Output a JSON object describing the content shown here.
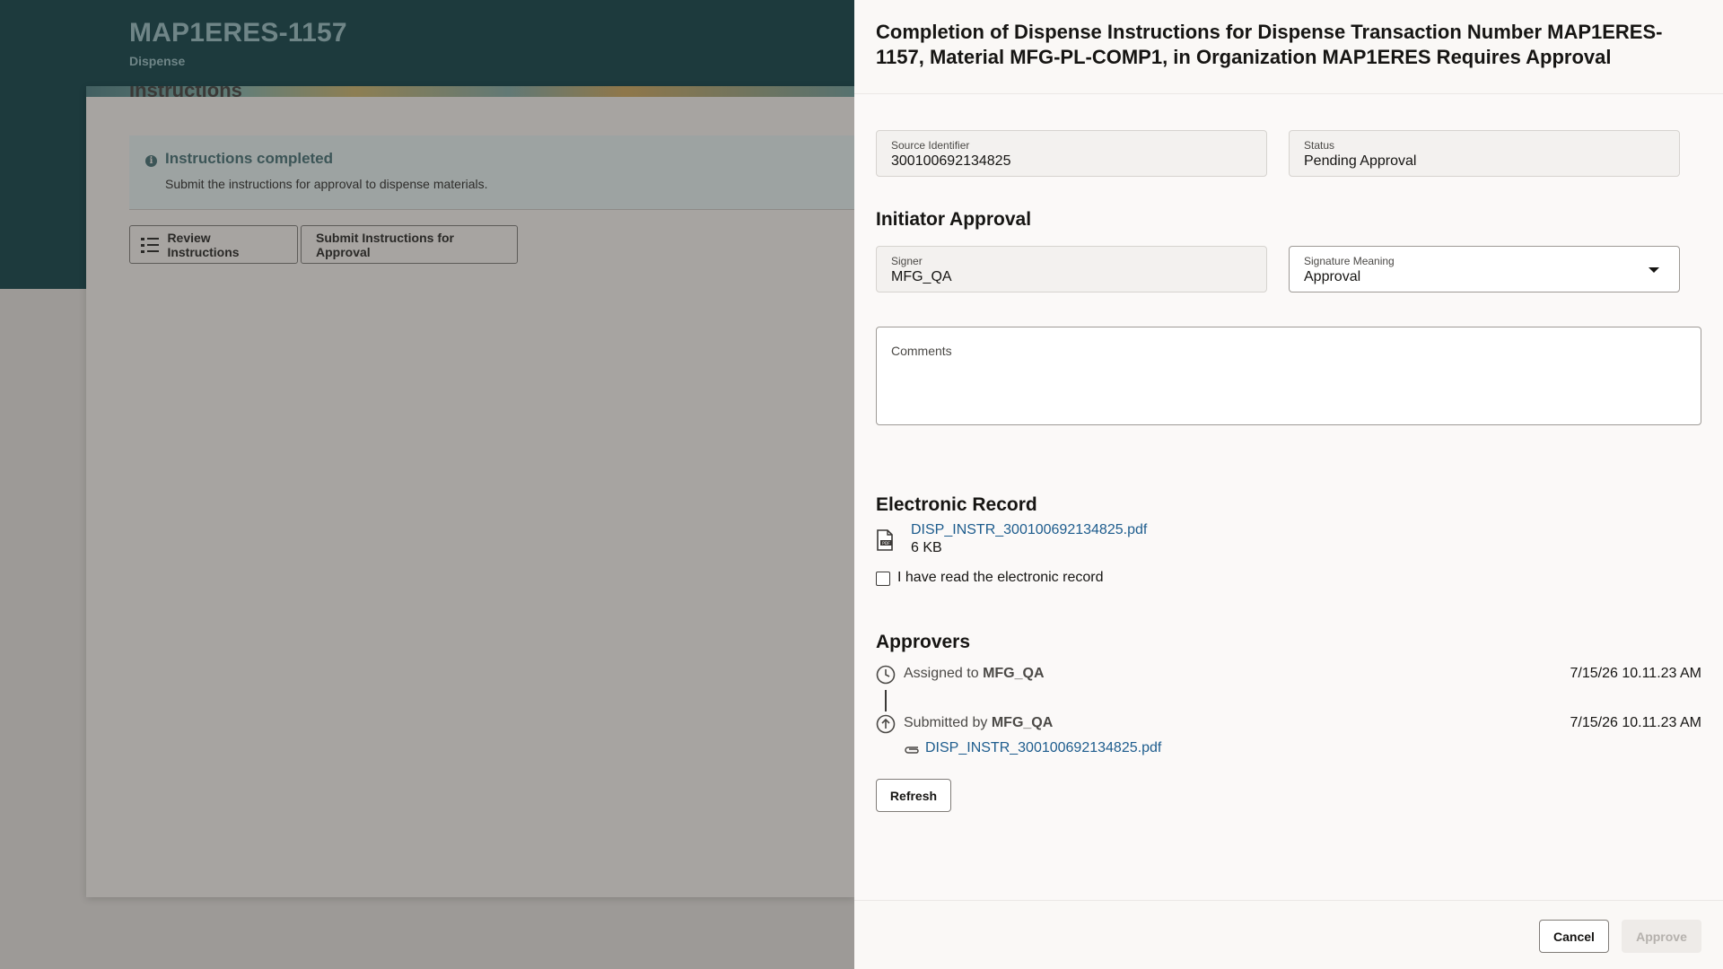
{
  "background": {
    "title": "MAP1ERES-1157",
    "subtitle": "Dispense",
    "section_title": "Instructions",
    "info": {
      "title": "Instructions completed",
      "text": "Submit the instructions for approval to dispense materials.",
      "icon": "info-icon"
    },
    "buttons": {
      "review": "Review Instructions",
      "submit": "Submit Instructions for Approval"
    }
  },
  "drawer": {
    "title": "Completion of Dispense Instructions for Dispense Transaction Number MAP1ERES-1157, Material MFG-PL-COMP1, in Organization MAP1ERES Requires Approval",
    "source_identifier": {
      "label": "Source Identifier",
      "value": "300100692134825"
    },
    "status": {
      "label": "Status",
      "value": "Pending Approval"
    },
    "initiator_section": "Initiator Approval",
    "signer": {
      "label": "Signer",
      "value": "MFG_QA"
    },
    "signature_meaning": {
      "label": "Signature Meaning",
      "value": "Approval"
    },
    "comments": {
      "label": "Comments",
      "value": ""
    },
    "electronic_record": {
      "heading": "Electronic Record",
      "file_name": "DISP_INSTR_300100692134825.pdf",
      "file_size": "6 KB",
      "checkbox_label": "I have read the electronic record",
      "checked": false
    },
    "approvers": {
      "heading": "Approvers",
      "entries": [
        {
          "prefix": "Assigned to",
          "user": "MFG_QA",
          "date": "7/15/26 10.11.23 AM",
          "icon": "clock-icon"
        },
        {
          "prefix": "Submitted by",
          "user": "MFG_QA",
          "date": "7/15/26 10.11.23 AM",
          "icon": "upload-icon",
          "attachment": "DISP_INSTR_300100692134825.pdf"
        }
      ],
      "refresh_label": "Refresh"
    },
    "footer": {
      "cancel_label": "Cancel",
      "approve_label": "Approve"
    }
  }
}
